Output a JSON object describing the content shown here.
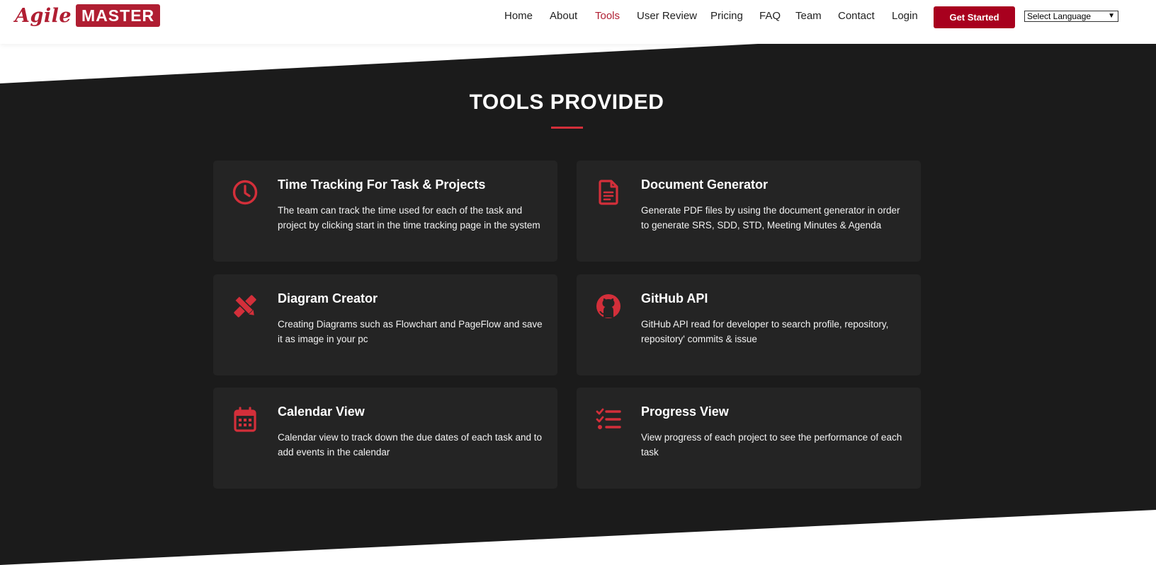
{
  "brand": {
    "logo_script": "Agile",
    "logo_box": "MASTER",
    "accent": "#b01e32"
  },
  "nav": {
    "items": [
      {
        "label": "Home",
        "active": false
      },
      {
        "label": "About",
        "active": false
      },
      {
        "label": "Tools",
        "active": true
      },
      {
        "label": "User Review",
        "active": false
      },
      {
        "label": "Pricing",
        "active": false
      },
      {
        "label": "FAQ",
        "active": false
      },
      {
        "label": "Team",
        "active": false
      },
      {
        "label": "Contact",
        "active": false
      },
      {
        "label": "Login",
        "active": false
      }
    ],
    "cta_label": "Get Started",
    "language_select": "Select Language"
  },
  "section": {
    "title": "TOOLS PROVIDED",
    "background": "#1b1b1b",
    "card_background": "#242424",
    "icon_color": "#d32f3a"
  },
  "tools": [
    {
      "icon": "clock-icon",
      "title": "Time Tracking For Task & Projects",
      "description": "The team can track the time used for each of the task and project by clicking start in the time tracking page in the system"
    },
    {
      "icon": "document-icon",
      "title": "Document Generator",
      "description": "Generate PDF files by using the document generator in order to generate SRS, SDD, STD, Meeting Minutes & Agenda"
    },
    {
      "icon": "pencil-ruler-icon",
      "title": "Diagram Creator",
      "description": "Creating Diagrams such as Flowchart and PageFlow and save it as image in your pc"
    },
    {
      "icon": "github-icon",
      "title": "GitHub API",
      "description": "GitHub API read for developer to search profile, repository, repository' commits & issue"
    },
    {
      "icon": "calendar-icon",
      "title": "Calendar View",
      "description": "Calendar view to track down the due dates of each task and to add events in the calendar"
    },
    {
      "icon": "checklist-icon",
      "title": "Progress View",
      "description": "View progress of each project to see the performance of each task"
    }
  ]
}
